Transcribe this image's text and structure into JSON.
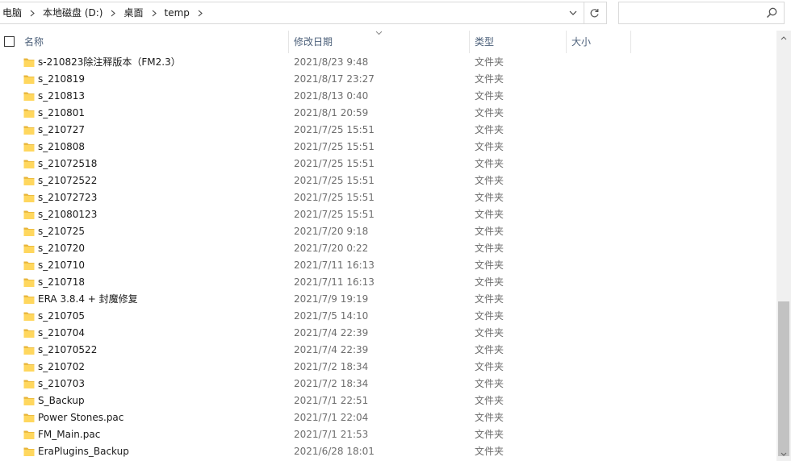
{
  "address": {
    "breadcrumbs": [
      "电脑",
      "本地磁盘 (D:)",
      "桌面",
      "temp"
    ]
  },
  "search": {
    "placeholder": ""
  },
  "columns": {
    "name": "名称",
    "date": "修改日期",
    "type": "类型",
    "size": "大小"
  },
  "files": [
    {
      "name": "s-210823除注释版本（FM2.3）",
      "date": "2021/8/23 9:48",
      "type": "文件夹"
    },
    {
      "name": "s_210819",
      "date": "2021/8/17 23:27",
      "type": "文件夹"
    },
    {
      "name": "s_210813",
      "date": "2021/8/13 0:40",
      "type": "文件夹"
    },
    {
      "name": "s_210801",
      "date": "2021/8/1 20:59",
      "type": "文件夹"
    },
    {
      "name": "s_210727",
      "date": "2021/7/25 15:51",
      "type": "文件夹"
    },
    {
      "name": "s_210808",
      "date": "2021/7/25 15:51",
      "type": "文件夹"
    },
    {
      "name": "s_21072518",
      "date": "2021/7/25 15:51",
      "type": "文件夹"
    },
    {
      "name": "s_21072522",
      "date": "2021/7/25 15:51",
      "type": "文件夹"
    },
    {
      "name": "s_21072723",
      "date": "2021/7/25 15:51",
      "type": "文件夹"
    },
    {
      "name": "s_21080123",
      "date": "2021/7/25 15:51",
      "type": "文件夹"
    },
    {
      "name": "s_210725",
      "date": "2021/7/20 9:18",
      "type": "文件夹"
    },
    {
      "name": "s_210720",
      "date": "2021/7/20 0:22",
      "type": "文件夹"
    },
    {
      "name": "s_210710",
      "date": "2021/7/11 16:13",
      "type": "文件夹"
    },
    {
      "name": "s_210718",
      "date": "2021/7/11 16:13",
      "type": "文件夹"
    },
    {
      "name": "ERA 3.8.4 + 封魔修复",
      "date": "2021/7/9 19:19",
      "type": "文件夹"
    },
    {
      "name": "s_210705",
      "date": "2021/7/5 14:10",
      "type": "文件夹"
    },
    {
      "name": "s_210704",
      "date": "2021/7/4 22:39",
      "type": "文件夹"
    },
    {
      "name": "s_21070522",
      "date": "2021/7/4 22:39",
      "type": "文件夹"
    },
    {
      "name": "s_210702",
      "date": "2021/7/2 18:34",
      "type": "文件夹"
    },
    {
      "name": "s_210703",
      "date": "2021/7/2 18:34",
      "type": "文件夹"
    },
    {
      "name": "S_Backup",
      "date": "2021/7/1 22:51",
      "type": "文件夹"
    },
    {
      "name": "Power Stones.pac",
      "date": "2021/7/1 22:04",
      "type": "文件夹"
    },
    {
      "name": "FM_Main.pac",
      "date": "2021/7/1 21:53",
      "type": "文件夹"
    },
    {
      "name": "EraPlugins_Backup",
      "date": "2021/6/28 18:01",
      "type": "文件夹"
    }
  ],
  "icons": {
    "folder": "folder-icon",
    "breadcrumb_separator": "chevron-right-icon",
    "address_dropdown": "chevron-down-icon",
    "refresh": "refresh-icon",
    "search": "search-icon",
    "sort": "sort-descending-icon"
  },
  "colors": {
    "folder": "#ffd75e",
    "header_text": "#4c607a",
    "secondary_text": "#6d6d6d",
    "scroll_thumb": "#c2c2c2"
  }
}
